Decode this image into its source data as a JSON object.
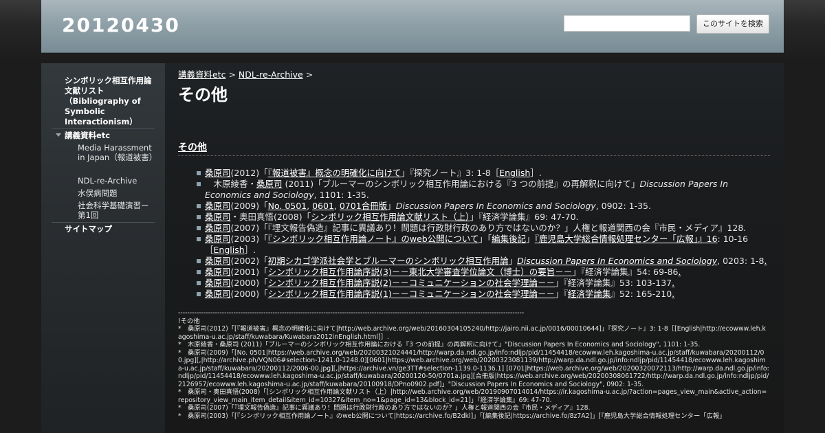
{
  "header": {
    "site_title": "20120430",
    "search_placeholder": "",
    "search_button": "このサイトを検索"
  },
  "sidebar": {
    "items": [
      {
        "label": "シンボリック相互作用論文献リスト（Bibliography of Symbolic Interactionism）"
      },
      {
        "label": "講義資料etc",
        "expanded": true,
        "children": [
          {
            "label": "Media Harassment in Japan（報道被害）"
          },
          {
            "label": "NDL-re-Archive"
          },
          {
            "label": "水俣病問題"
          },
          {
            "label": "社会科学基礎演習ー第1回"
          }
        ]
      },
      {
        "label": "サイトマップ"
      }
    ]
  },
  "main": {
    "breadcrumb": [
      {
        "label": "講義資料etc"
      },
      {
        "label": "NDL-re-Archive"
      }
    ],
    "breadcrumb_sep": ">",
    "title": "その他",
    "section_heading": "その他",
    "refs": [
      {
        "segments": [
          {
            "t": "桑原司",
            "link": true
          },
          {
            "t": "(2012)「"
          },
          {
            "t": "『報道被害』概念の明確化に向けて",
            "link": true
          },
          {
            "t": "」『探究ノート』3: 1-8［"
          },
          {
            "t": "English",
            "link": true
          },
          {
            "t": "］."
          }
        ]
      },
      {
        "segments": [
          {
            "t": "　木原綾香・"
          },
          {
            "t": "桑原司",
            "link": true
          },
          {
            "t": " (2011)「ブルーマーのシンボリック相互作用論における『3 つの前提』の再解釈に向けて」"
          },
          {
            "t": "Discussion Papers In Economics and Sociology",
            "em": true
          },
          {
            "t": ", 1101: 1-35."
          }
        ]
      },
      {
        "segments": [
          {
            "t": "桑原司",
            "link": true
          },
          {
            "t": "(2009)「"
          },
          {
            "t": "No. 0501",
            "link": true
          },
          {
            "t": ", "
          },
          {
            "t": "0601",
            "link": true
          },
          {
            "t": ", "
          },
          {
            "t": "0701合冊版",
            "link": true
          },
          {
            "t": "」"
          },
          {
            "t": "Discussion Papers In Economics and Sociology",
            "em": true
          },
          {
            "t": ", 0902: 1-35."
          }
        ]
      },
      {
        "segments": [
          {
            "t": "桑原司",
            "link": true
          },
          {
            "t": "・奥田真悟(2008)「"
          },
          {
            "t": "シンボリック相互作用論文献リスト（上）",
            "link": true
          },
          {
            "t": "」『経済学論集』69: 47-70."
          }
        ]
      },
      {
        "segments": [
          {
            "t": "桑原司",
            "link": true
          },
          {
            "t": "(2007)「『埋文報告偽造』記事に異議あり！問題は行政財行政のあり方ではないのか？」人権と報道関西の会『市民・メディア』128."
          }
        ]
      },
      {
        "segments": [
          {
            "t": "桑原司",
            "link": true
          },
          {
            "t": "(2003)「"
          },
          {
            "t": "『シンボリック相互作用論ノート』のweb公開について",
            "link": true
          },
          {
            "t": "」「"
          },
          {
            "t": "編集後記",
            "link": true
          },
          {
            "t": "」"
          },
          {
            "t": "『鹿児島大学総合情報処理センター「広報」』16",
            "link": true
          },
          {
            "t": ": 10-16［"
          },
          {
            "t": "English",
            "link": true
          },
          {
            "t": "］."
          }
        ]
      },
      {
        "segments": [
          {
            "t": "桑原司",
            "link": true
          },
          {
            "t": "(2002)「"
          },
          {
            "t": "初期シカゴ学派社会学とブルーマーのシンボリック相互作用論",
            "link": true
          },
          {
            "t": "」"
          },
          {
            "t": "Discussion Papers In Economics and Sociology",
            "em": true,
            "link": true
          },
          {
            "t": ", 0203: 1-8"
          },
          {
            "t": ".",
            "link": true
          }
        ]
      },
      {
        "segments": [
          {
            "t": "桑原司",
            "link": true
          },
          {
            "t": "(2001)「"
          },
          {
            "t": "シンボリック相互作用論序説(3)－－東北大学審査学位論文（博士）の要旨－－",
            "link": true
          },
          {
            "t": "」『経済学論集』54: 69-86"
          },
          {
            "t": ".",
            "link": true
          }
        ]
      },
      {
        "segments": [
          {
            "t": "桑原司",
            "link": true
          },
          {
            "t": "(2000)「"
          },
          {
            "t": "シンボリック相互作用論序説(2)－－コミュニケーションの社会学理論－－",
            "link": true
          },
          {
            "t": "」『経済学論集』53: 103-137"
          },
          {
            "t": ".",
            "link": true
          }
        ]
      },
      {
        "segments": [
          {
            "t": "桑原司",
            "link": true
          },
          {
            "t": "(2000)「"
          },
          {
            "t": "シンボリック相互作用論序説(1)－－コミュニケーションの社会学理論－－",
            "link": true
          },
          {
            "t": "」『"
          },
          {
            "t": "経済学論集",
            "link": true
          },
          {
            "t": "』52: 165-210"
          },
          {
            "t": ".",
            "link": true
          }
        ]
      }
    ],
    "raw_text": "------------------------------------------------------------------------------------------------------------------------------------------------------\n!その他\n*　桑原司(2012)「[『報道被害』概念の明確化に向けて|http://web.archive.org/web/20160304105240/http://jairo.nii.ac.jp/0016/00010644]」『探究ノート』3: 1-8［[English|http://ecowww.leh.kagoshima-u.ac.jp/staff/kuwabara/Kuwabara2012inEnglish.html]］.\n*　木原綾香・桑原司 (2011)「ブルーマーのシンボリック相互作用論における『3 つの前提』の再解釈に向けて」\"Discussion Papers In Economics and Sociology\", 1101: 1-35.\n*　桑原司(2009)「[No. 0501|https://web.archive.org/web/20200321024441/http://warp.da.ndl.go.jp/info:ndljp/pid/11454418/ecowww.leh.kagoshima-u.ac.jp/staff/kuwabara/20200112/00.jpg][,|http://archive.ph/VQN06#selection-1241.0-1248.0][0601|https://web.archive.org/web/20200323081139/http://warp.da.ndl.go.jp/info:ndljp/pid/11454418/ecowww.leh.kagoshima-u.ac.jp/staff/kuwabara/20200112/2006-00.jpg][,|https://archive.vn/ge3TT#selection-1139.0-1136.1] [0701|https://web.archive.org/web/20200320072113/http://warp.da.ndl.go.jp/info:ndljp/pid/11454418/ecowww.leh.kagoshima-u.ac.jp/staff/kuwabara/20200120-50/0701a.jpg][合冊版|https://web.archive.org/web/20200308061722/http://warp.da.ndl.go.jp/info:ndljp/pid/2126957/ecowww.leh.kagoshima-u.ac.jp/staff/kuwabara/20100918/DPno0902.pdf]」\"Discussion Papers In Economics and Sociology\", 0902: 1-35.\n*　桑原司・奥田真悟(2008)「[シンボリック相互作用論文献リスト（上）|http://web.archive.org/web/20190907014014/https://ir.kagoshima-u.ac.jp/?action=pages_view_main&active_action=repository_view_main_item_detail&item_id=10327&item_no=1&page_id=13&block_id=21]」『経済学論集』69: 47-70.\n*　桑原司(2007)「『埋文報告偽造』記事に異議あり！問題は行政財行政のあり方ではないのか？」人権と報道関西の会『市民・メディア』128.\n*　桑原司(2003)「[『シンボリック相互作用論ノート』のweb公開について|https://archive.fo/B2dkl]」「[編集後記|https://archive.fo/8z7A2]」[『鹿児島大学総合情報処理センター「広報」"
  }
}
